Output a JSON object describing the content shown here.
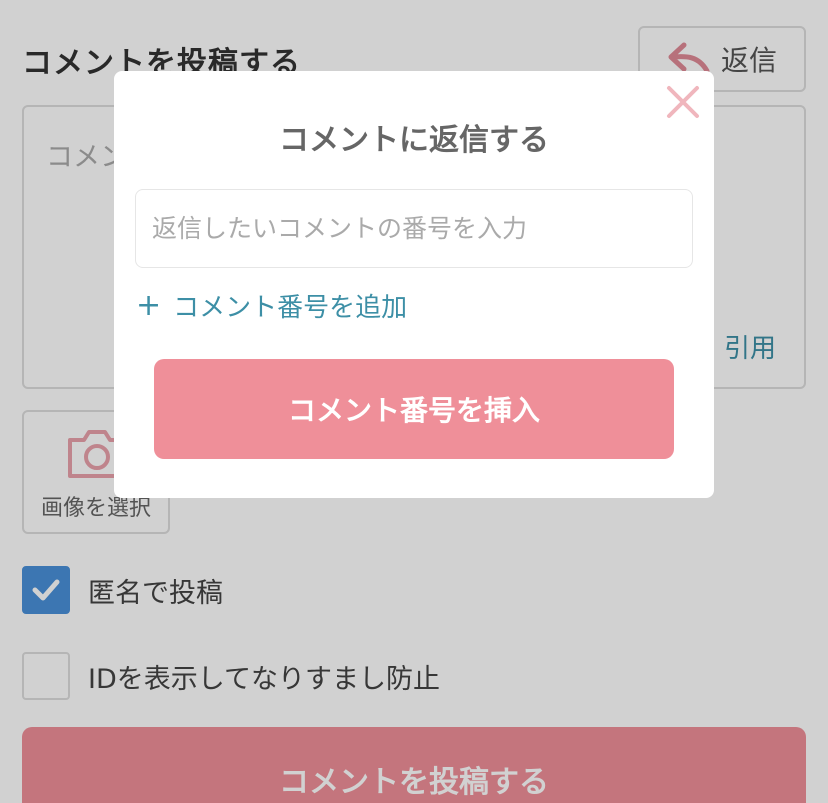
{
  "page": {
    "title": "コメントを投稿する",
    "reply_label": "返信",
    "comment_placeholder": "コメント",
    "quote_label": "引用",
    "image_label": "画像を選択",
    "anonymous_label": "匿名で投稿",
    "anonymous_checked": true,
    "show_id_label": "IDを表示してなりすまし防止",
    "show_id_checked": false,
    "submit_label": "コメントを投稿する"
  },
  "modal": {
    "title": "コメントに返信する",
    "input_placeholder": "返信したいコメントの番号を入力",
    "input_value": "",
    "add_label": "コメント番号を追加",
    "insert_label": "コメント番号を挿入"
  },
  "colors": {
    "accent": "#ef8f99",
    "link": "#3d8fa6",
    "checkbox": "#4a90d9"
  }
}
